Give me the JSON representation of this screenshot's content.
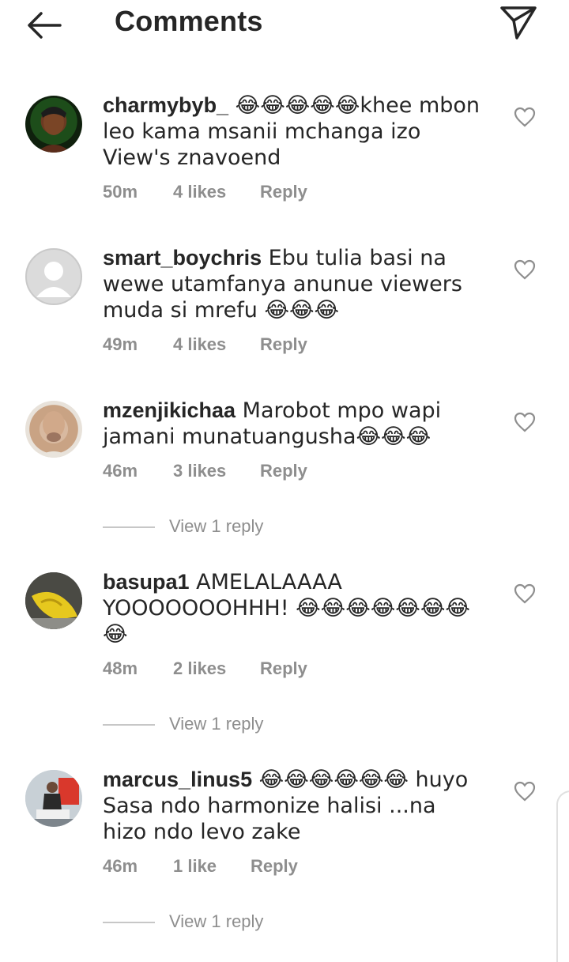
{
  "header": {
    "title": "Comments",
    "back_icon": "arrow-left-icon",
    "send_icon": "paper-plane-icon"
  },
  "comments": [
    {
      "username": "charmybyb_",
      "text": " 😂😂😂😂😂khee mbon leo kama msanii mchanga izo View's znavoend",
      "time": "50m",
      "likes": "4 likes",
      "reply": "Reply",
      "view_replies": ""
    },
    {
      "username": "smart_boychris",
      "text": " Ebu tulia basi na wewe utamfanya anunue viewers muda si mrefu 😂😂😂",
      "time": "49m",
      "likes": "4 likes",
      "reply": "Reply",
      "view_replies": ""
    },
    {
      "username": "mzenjikichaa",
      "text": " Marobot mpo wapi jamani munatuangusha😂😂😂",
      "time": "46m",
      "likes": "3 likes",
      "reply": "Reply",
      "view_replies": "View 1 reply"
    },
    {
      "username": "basupa1",
      "text": " AMELALAAAA YOOOOOOOHHH! 😂😂😂😂😂😂😂😂",
      "time": "48m",
      "likes": "2 likes",
      "reply": "Reply",
      "view_replies": "View 1 reply"
    },
    {
      "username": "marcus_linus5",
      "text": " 😂😂😂😂😂😂 huyo Sasa ndo harmonize halisi ...na hizo ndo levo zake",
      "time": "46m",
      "likes": "1 like",
      "reply": "Reply",
      "view_replies": "View 1 reply"
    }
  ],
  "colors": {
    "text": "#262626",
    "muted": "#8e8e8e",
    "divider": "#c7c7c7"
  }
}
